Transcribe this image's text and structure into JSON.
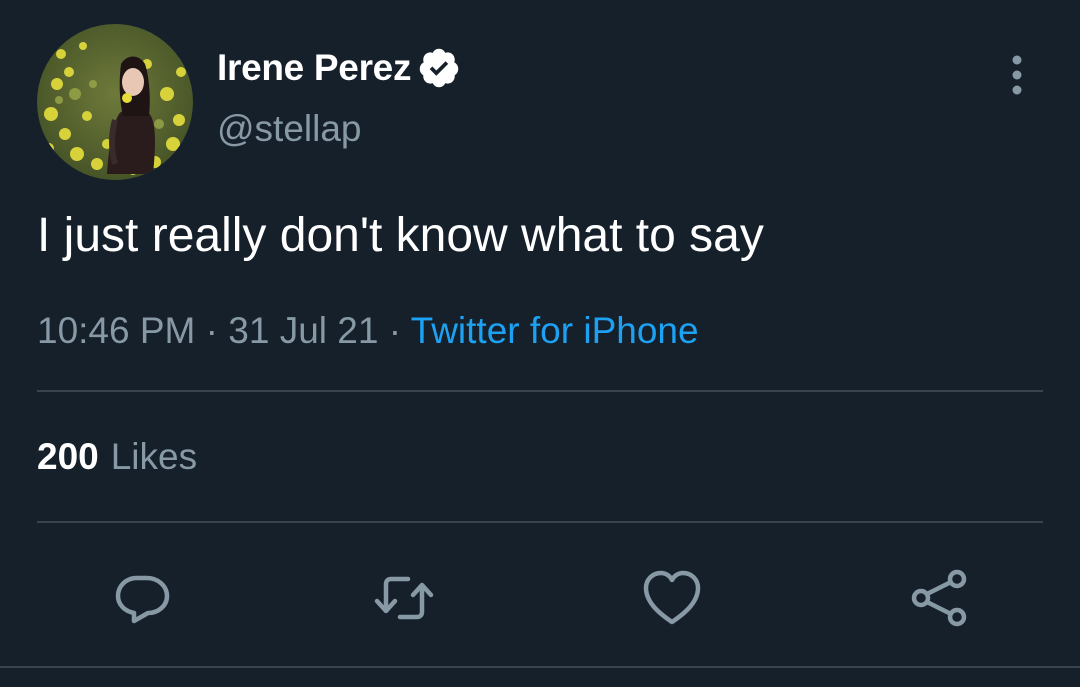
{
  "tweet": {
    "author": {
      "display_name": "Irene Perez",
      "handle": "@stellap",
      "verified": true
    },
    "text": "I just really don't know what to say",
    "time": "10:46 PM",
    "date": "31 Jul 21",
    "separator": "·",
    "source": "Twitter for iPhone",
    "likes": {
      "count": "200",
      "label": "Likes"
    }
  },
  "icons": {
    "verified": "verified-badge-icon",
    "more": "more-vertical-icon",
    "reply": "reply-icon",
    "retweet": "retweet-icon",
    "like": "heart-icon",
    "share": "share-icon"
  },
  "colors": {
    "background": "#15202b",
    "text_primary": "#ffffff",
    "text_secondary": "#8899a6",
    "link": "#1da1f2",
    "divider": "#38444d"
  }
}
